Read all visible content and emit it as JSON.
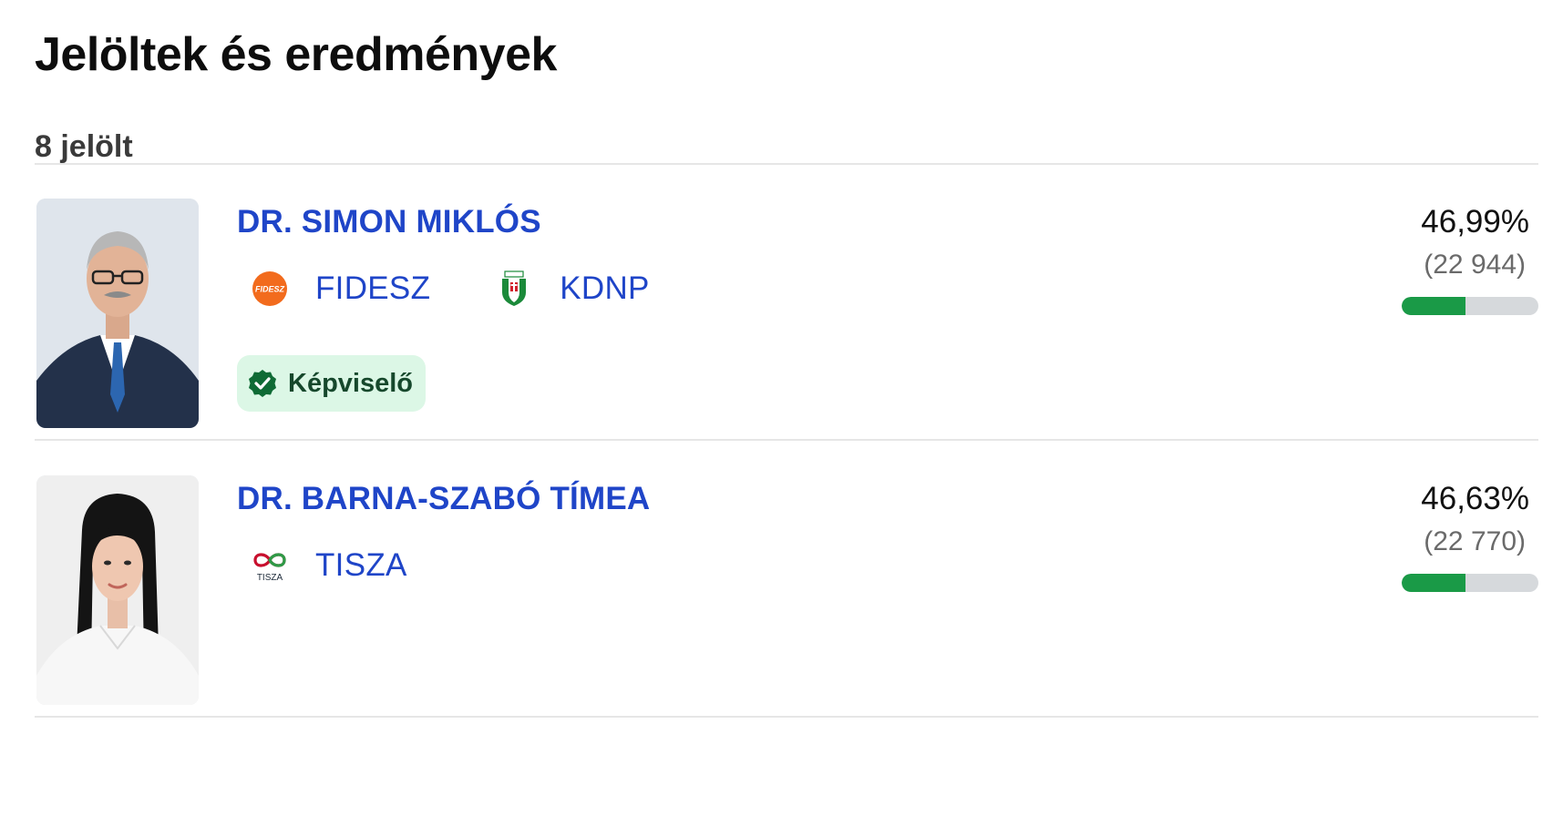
{
  "header": {
    "title": "Jelöltek és eredmények",
    "candidate_count": "8 jelölt"
  },
  "candidates": [
    {
      "name": "DR. SIMON MIKLÓS",
      "parties": [
        {
          "name": "FIDESZ",
          "logo_text": "FIDESZ",
          "icon": "fidesz-logo-icon",
          "color": "#f26b1d"
        },
        {
          "name": "KDNP",
          "icon": "kdnp-shield-icon",
          "color": "#1b8a3a"
        }
      ],
      "badge": {
        "label": "Képviselő",
        "icon": "check-badge-icon",
        "color": "#0f6b35"
      },
      "percent": "46,99%",
      "votes": "(22 944)",
      "bar_fraction": 0.4699
    },
    {
      "name": "DR. BARNA-SZABÓ TÍMEA",
      "parties": [
        {
          "name": "TISZA",
          "logo_text": "TISZA",
          "icon": "tisza-logo-icon",
          "color": "#c8102e"
        }
      ],
      "percent": "46,63%",
      "votes": "(22 770)",
      "bar_fraction": 0.4663
    }
  ],
  "colors": {
    "link": "#1f45c8",
    "bar_fill": "#1a9a47",
    "bar_track": "#d6d9dc",
    "badge_bg": "#dcf7e6"
  }
}
